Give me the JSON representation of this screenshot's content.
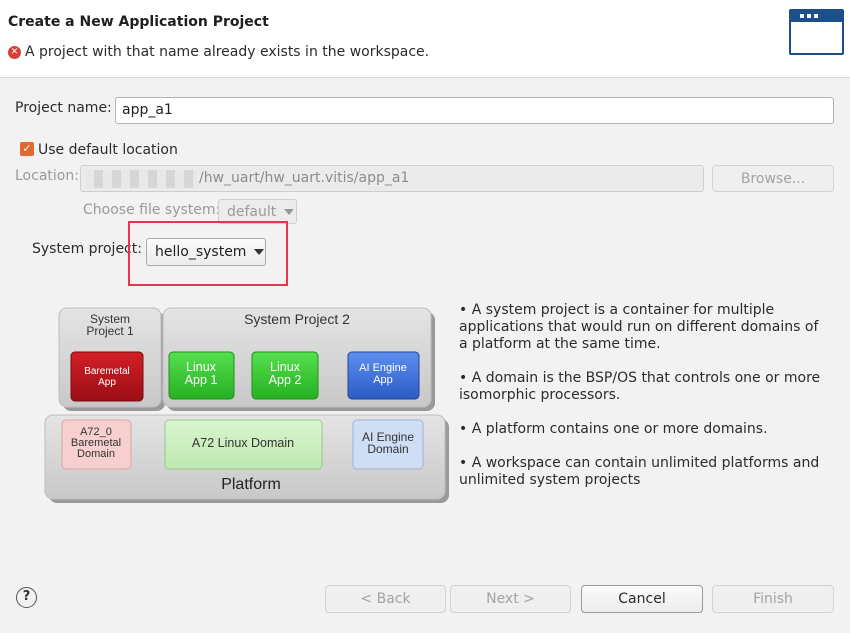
{
  "header": {
    "title": "Create a New Application Project",
    "error_message": "A project with that name already exists in the workspace."
  },
  "form": {
    "project_name_label": "Project name:",
    "project_name_value": "app_a1",
    "use_default_location_label": "Use default location",
    "use_default_location_checked": true,
    "location_label": "Location:",
    "location_value": "/hw_uart/hw_uart.vitis/app_a1",
    "browse_label": "Browse...",
    "file_system_label": "Choose file system:",
    "file_system_value": "default",
    "system_project_label": "System project:",
    "system_project_value": "hello_system"
  },
  "diagram": {
    "system_project_1": "System Project 1",
    "system_project_2": "System Project 2",
    "baremetal_app": "Baremetal App",
    "linux_app_1": "Linux App 1",
    "linux_app_2": "Linux App 2",
    "ai_engine_app": "AI Engine App",
    "a72_0_baremetal_domain": "A72_0 Baremetal Domain",
    "a72_linux_domain": "A72 Linux Domain",
    "ai_engine_domain": "AI Engine Domain",
    "platform": "Platform"
  },
  "info": {
    "bullet1": "• A system project is a container for multiple applications that would run on different domains of a platform at the same time.",
    "bullet2": "• A domain is the BSP/OS that controls one or more isomorphic processors.",
    "bullet3": "• A platform contains one or more domains.",
    "bullet4": "• A workspace can contain unlimited platforms and unlimited system projects"
  },
  "footer": {
    "help_icon": "?",
    "back_label": "< Back",
    "next_label": "Next >",
    "cancel_label": "Cancel",
    "finish_label": "Finish"
  },
  "colors": {
    "error_red": "#d9403a",
    "checkbox_orange": "#e36a2e",
    "highlight_red": "#e8344e",
    "baremetal_red": "#b0141c",
    "linux_green": "#3fd33a",
    "ai_engine_blue": "#3a6fd8"
  }
}
